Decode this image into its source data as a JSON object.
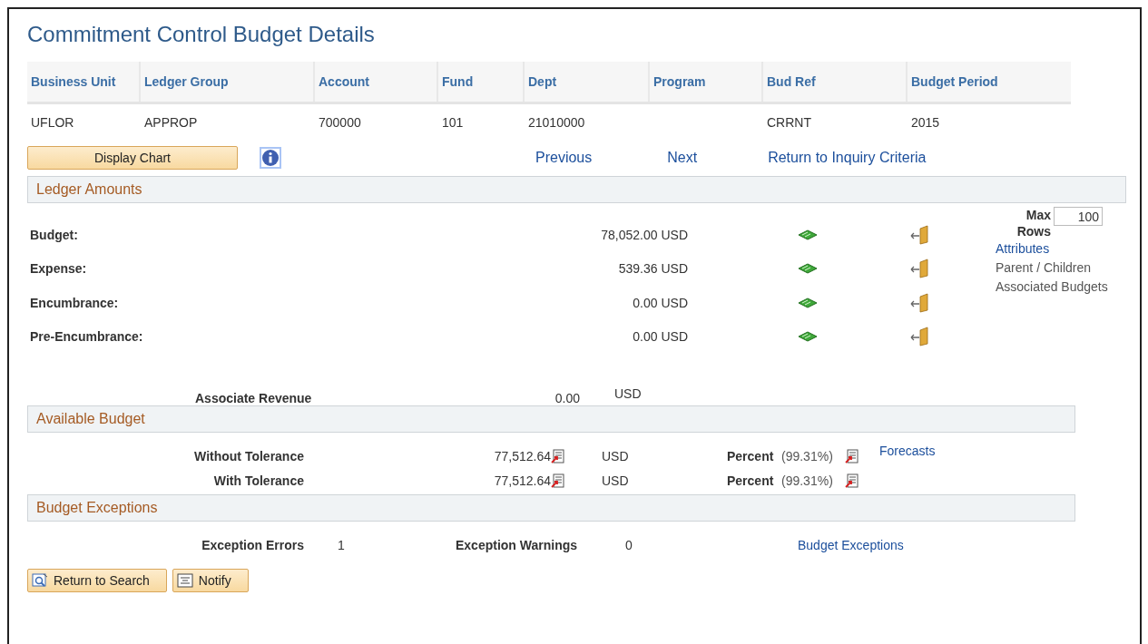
{
  "page_title": "Commitment Control Budget Details",
  "key_grid": {
    "columns": [
      {
        "header": "Business Unit",
        "value": "UFLOR"
      },
      {
        "header": "Ledger Group",
        "value": "APPROP"
      },
      {
        "header": "Account",
        "value": "700000"
      },
      {
        "header": "Fund",
        "value": "101"
      },
      {
        "header": "Dept",
        "value": "21010000"
      },
      {
        "header": "Program"
      },
      {
        "header": "Bud Ref",
        "value": "CRRNT"
      },
      {
        "header": "Budget Period",
        "value": "2015"
      }
    ]
  },
  "display_chart_button": "Display Chart",
  "nav_links": [
    "Previous",
    "Next",
    "Return to Inquiry Criteria"
  ],
  "ledger_amounts": {
    "title": "Ledger Amounts",
    "rows": [
      {
        "label": "Budget:",
        "amount": "78,052.00 USD"
      },
      {
        "label": "Expense:",
        "amount": "539.36 USD"
      },
      {
        "label": "Encumbrance:",
        "amount": "0.00 USD"
      },
      {
        "label": "Pre-Encumbrance:",
        "amount": "0.00 USD"
      }
    ],
    "max_rows": {
      "label": "Max Rows",
      "value": "100"
    },
    "side_links": [
      {
        "label": "Attributes",
        "disabled": false
      },
      {
        "label": "Parent / Children",
        "disabled": true
      },
      {
        "label": "Associated Budgets",
        "disabled": true
      }
    ],
    "associate_revenue": {
      "label": "Associate Revenue",
      "amount": "0.00",
      "currency": "USD"
    }
  },
  "available_budget": {
    "title": "Available Budget",
    "rows": [
      {
        "label": "Without Tolerance",
        "amount": "77,512.64",
        "currency": "USD",
        "percent_label": "Percent",
        "percent": "(99.31%)",
        "link": "Forecasts"
      },
      {
        "label": "With Tolerance",
        "amount": "77,512.64",
        "currency": "USD",
        "percent_label": "Percent",
        "percent": "(99.31%)"
      }
    ]
  },
  "budget_exceptions": {
    "title": "Budget Exceptions",
    "errors_label": "Exception Errors",
    "errors": "1",
    "warnings_label": "Exception Warnings",
    "warnings": "0",
    "link": "Budget Exceptions"
  },
  "bottom_buttons": [
    {
      "kind": "search",
      "label": "Return to Search"
    },
    {
      "kind": "notify",
      "label": "Notify"
    }
  ]
}
